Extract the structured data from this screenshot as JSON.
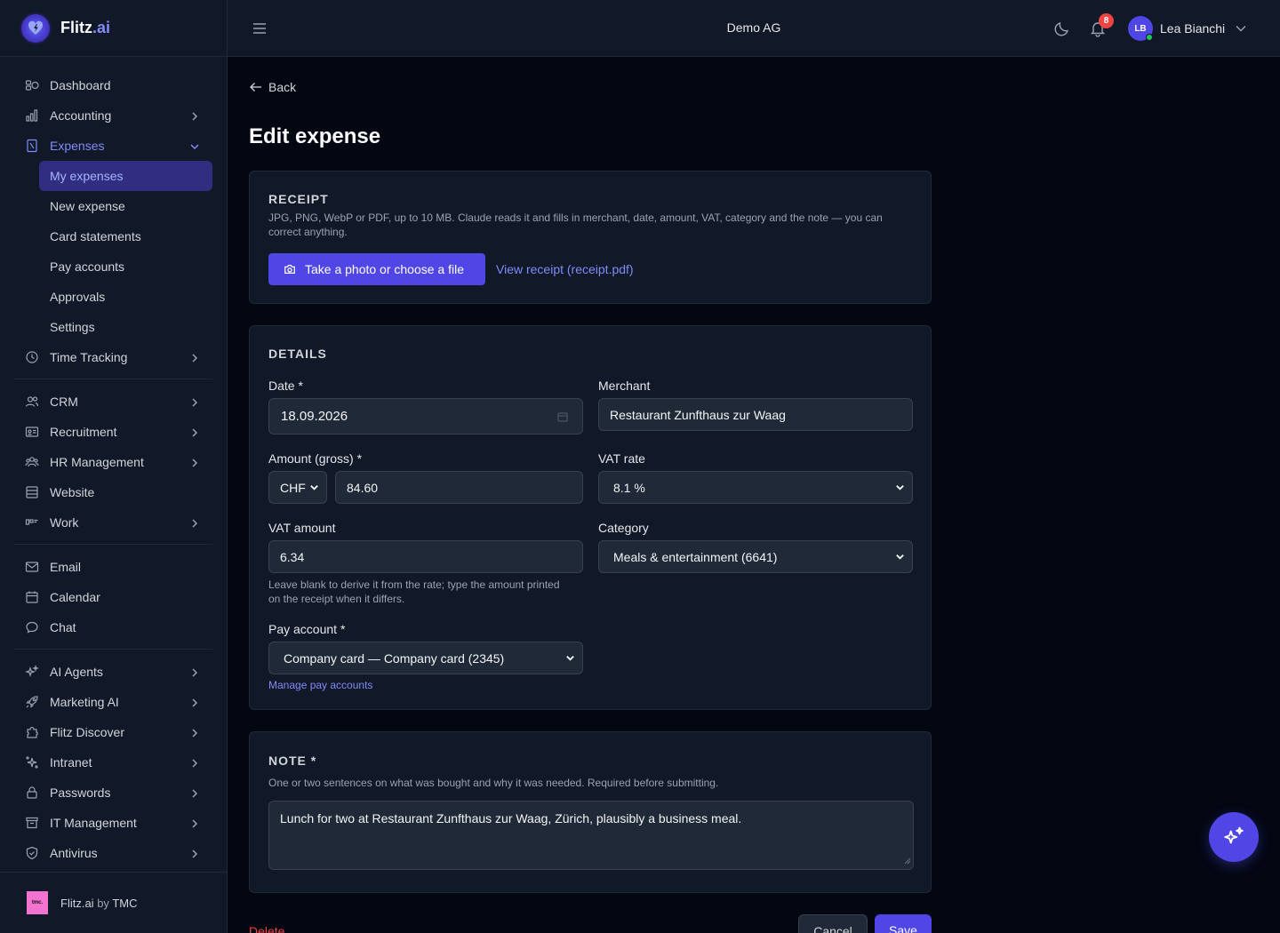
{
  "brand": {
    "name": "Flitz",
    "suffix": ".ai"
  },
  "topbar": {
    "company": "Demo AG",
    "notifications_count": "8",
    "user_initials": "LB",
    "user_name": "Lea Bianchi"
  },
  "sidebar": {
    "group1": [
      {
        "label": "Dashboard",
        "icon": "dashboard-icon",
        "has_chevron": false
      },
      {
        "label": "Accounting",
        "icon": "chart-bars-icon",
        "has_chevron": true
      },
      {
        "label": "Expenses",
        "icon": "receipt-icon",
        "has_chevron": true,
        "active": true,
        "expanded": true
      }
    ],
    "expenses_sub": [
      {
        "label": "My expenses",
        "active": true
      },
      {
        "label": "New expense"
      },
      {
        "label": "Card statements"
      },
      {
        "label": "Pay accounts"
      },
      {
        "label": "Approvals"
      },
      {
        "label": "Settings"
      }
    ],
    "time_tracking": {
      "label": "Time Tracking",
      "icon": "clock-icon"
    },
    "group2": [
      {
        "label": "CRM",
        "icon": "users-icon",
        "has_chevron": true
      },
      {
        "label": "Recruitment",
        "icon": "id-card-icon",
        "has_chevron": true
      },
      {
        "label": "HR Management",
        "icon": "people-icon",
        "has_chevron": true
      },
      {
        "label": "Website",
        "icon": "window-icon",
        "has_chevron": false
      },
      {
        "label": "Work",
        "icon": "kanban-icon",
        "has_chevron": true
      }
    ],
    "group3": [
      {
        "label": "Email",
        "icon": "mail-icon"
      },
      {
        "label": "Calendar",
        "icon": "calendar-icon"
      },
      {
        "label": "Chat",
        "icon": "chat-icon"
      }
    ],
    "group4": [
      {
        "label": "AI Agents",
        "icon": "sparkles-icon",
        "has_chevron": true
      },
      {
        "label": "Marketing AI",
        "icon": "rocket-icon",
        "has_chevron": true
      },
      {
        "label": "Flitz Discover",
        "icon": "puzzle-icon",
        "has_chevron": true
      },
      {
        "label": "Intranet",
        "icon": "sparkle-network-icon",
        "has_chevron": true
      },
      {
        "label": "Passwords",
        "icon": "lock-icon",
        "has_chevron": true
      },
      {
        "label": "IT Management",
        "icon": "archive-icon",
        "has_chevron": true
      },
      {
        "label": "Antivirus",
        "icon": "shield-icon",
        "has_chevron": true
      }
    ],
    "footer": {
      "brand": "Flitz.ai",
      "by": "by",
      "company": "TMC",
      "logo_text": "tmc."
    }
  },
  "page": {
    "back_label": "Back",
    "title": "Edit expense"
  },
  "receipt": {
    "title": "RECEIPT",
    "help_line1": "JPG, PNG, WebP or PDF, up to 10 MB. Claude reads it and fills in merchant, date, amount, VAT, category and the note — you can",
    "help_line2": "correct anything.",
    "upload_button": "Take a photo or choose a file",
    "view_link": "View receipt (receipt.pdf)"
  },
  "details": {
    "title": "DETAILS",
    "date_label": "Date *",
    "date_value": "18.09.2026",
    "merchant_label": "Merchant",
    "merchant_value": "Restaurant Zunfthaus zur Waag",
    "amount_label": "Amount (gross) *",
    "currency_value": "CHF",
    "amount_value": "84.60",
    "vat_rate_label": "VAT rate",
    "vat_rate_value": "8.1 %",
    "vat_amount_label": "VAT amount",
    "vat_amount_value": "6.34",
    "vat_help_line1": "Leave blank to derive it from the rate; type the amount printed",
    "vat_help_line2": "on the receipt when it differs.",
    "category_label": "Category",
    "category_value": "Meals & entertainment (6641)",
    "pay_account_label": "Pay account *",
    "pay_account_value": "Company card — Company card (2345)",
    "manage_link": "Manage pay accounts"
  },
  "note": {
    "title": "NOTE *",
    "help": "One or two sentences on what was bought and why it was needed. Required before submitting.",
    "value": "Lunch for two at Restaurant Zunfthaus zur Waag, Zürich, plausibly a business meal."
  },
  "actions": {
    "delete": "Delete",
    "cancel": "Cancel",
    "save": "Save"
  },
  "colors": {
    "accent": "#4f46e5",
    "accent_light": "#818cf8",
    "danger": "#ef4444",
    "online": "#22c55e"
  }
}
